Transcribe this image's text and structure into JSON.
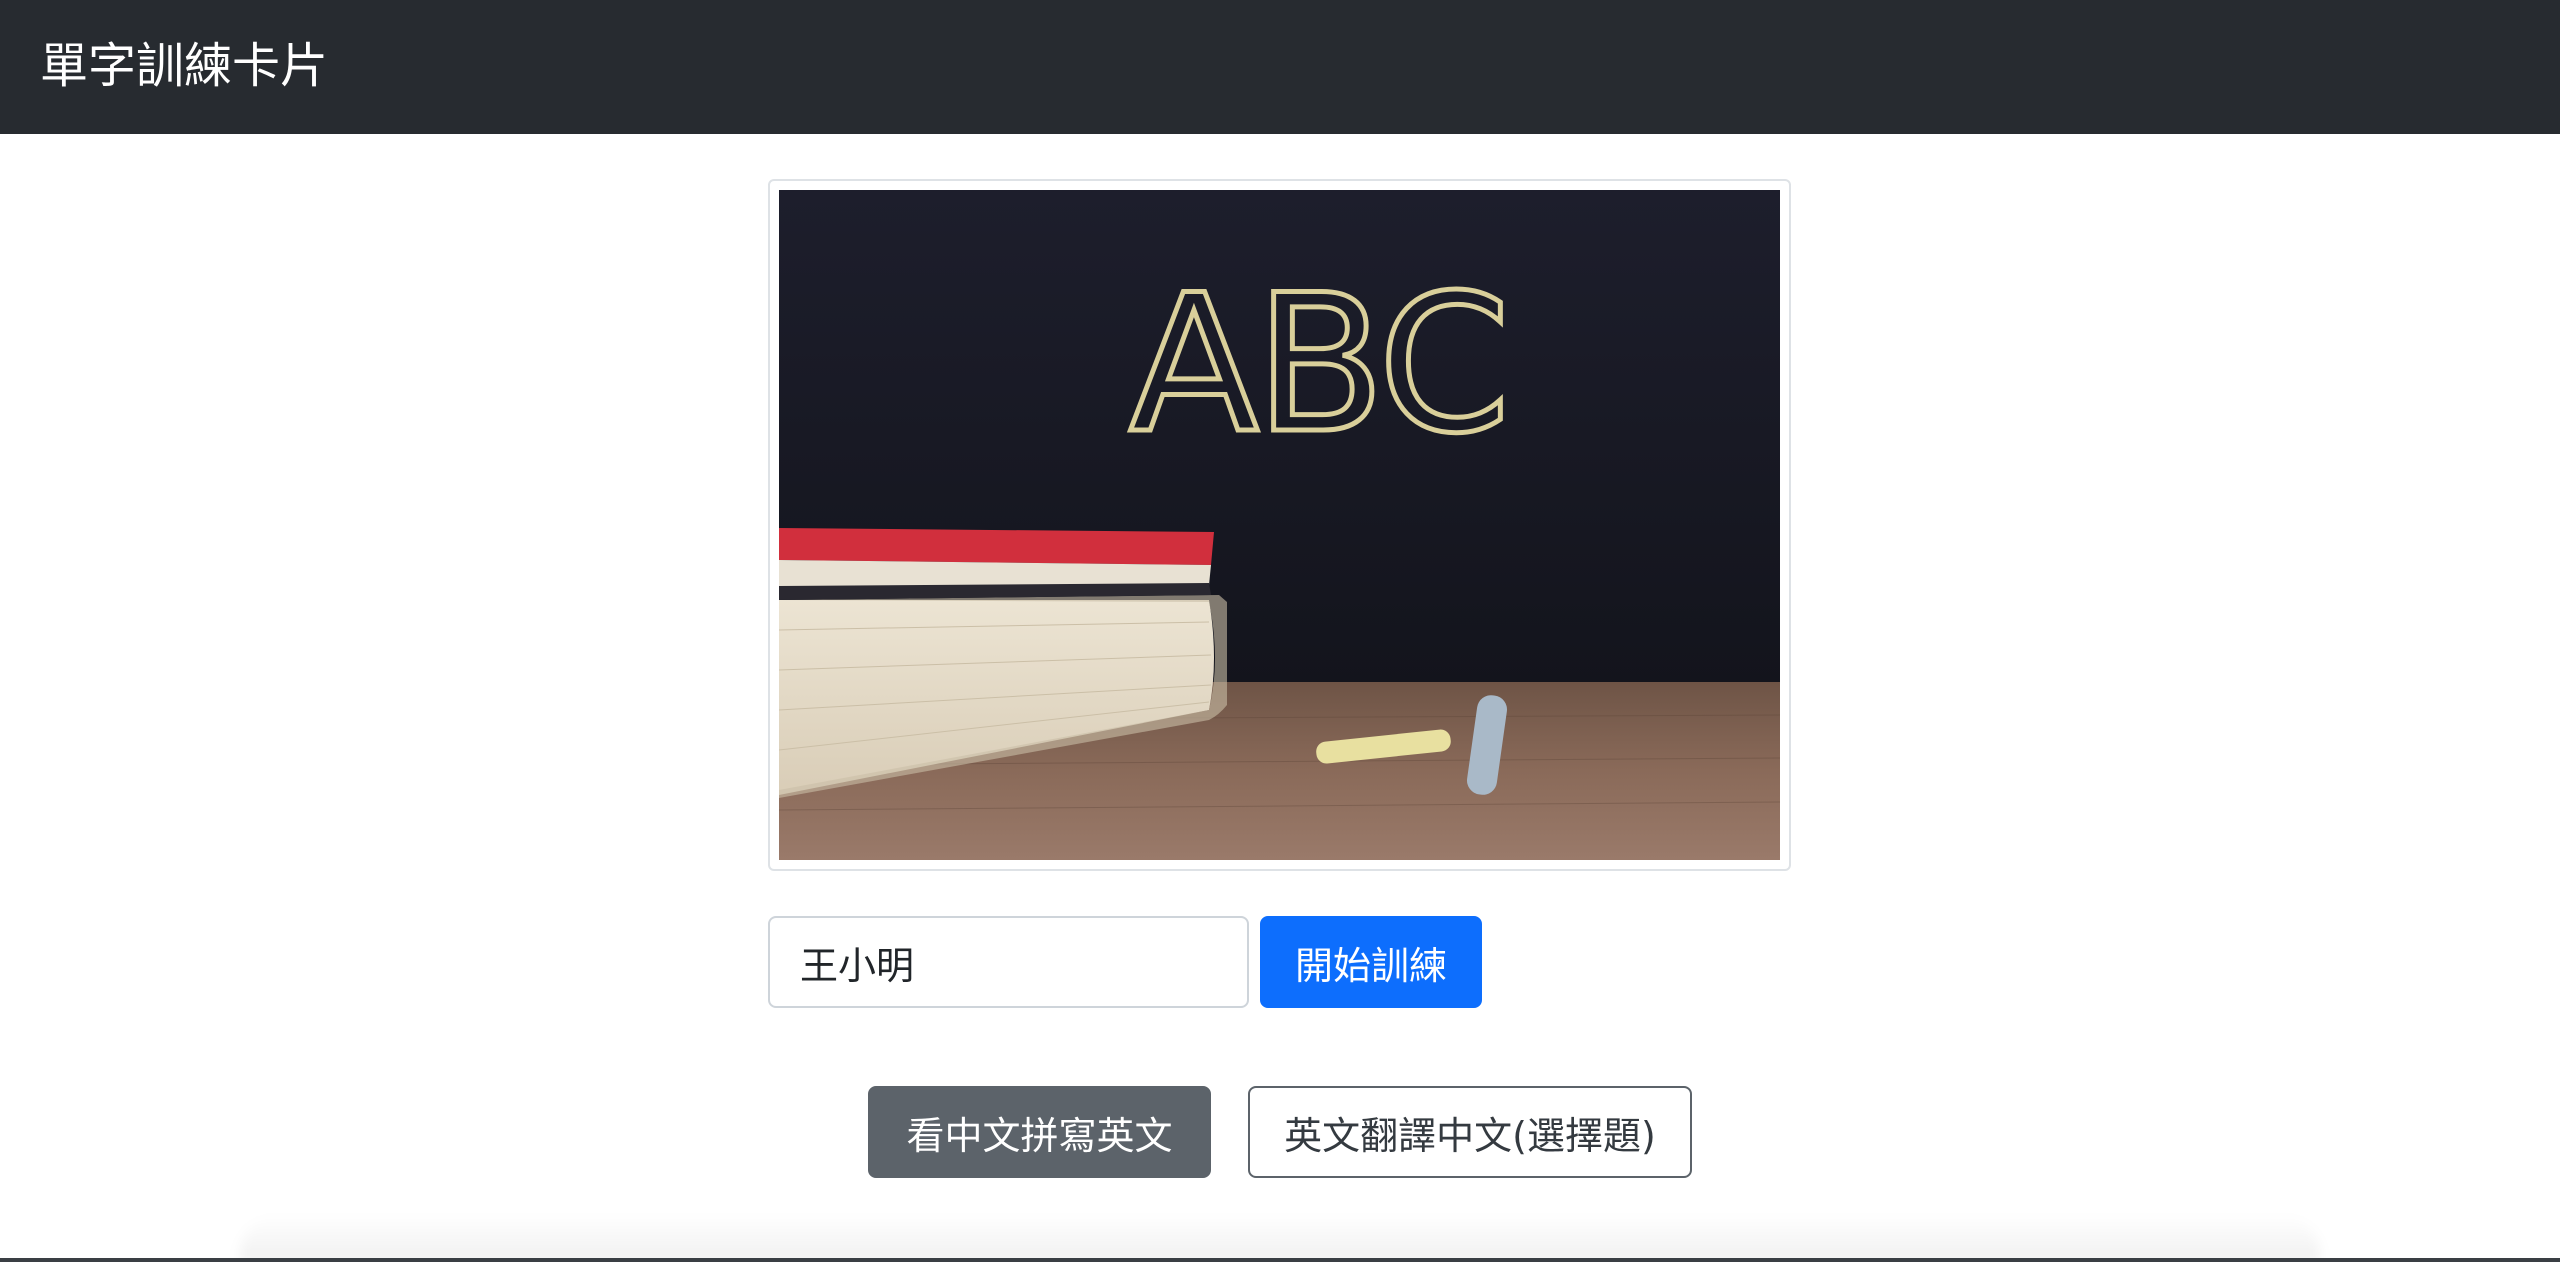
{
  "navbar": {
    "brand": "單字訓練卡片"
  },
  "hero_image": {
    "chalkboard_text": "ABC"
  },
  "name_form": {
    "name_value": "王小明",
    "start_button": "開始訓練"
  },
  "modes": {
    "spell_button": "看中文拼寫英文",
    "translate_button": "英文翻譯中文(選擇題)"
  },
  "colors": {
    "navbar": "#272b30",
    "primary": "#0d6efd",
    "secondary": "#5c636a"
  }
}
